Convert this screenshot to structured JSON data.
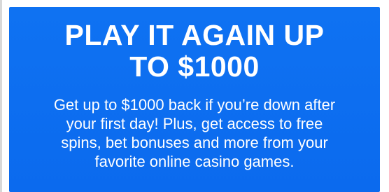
{
  "promo": {
    "headline_lines": [
      "PLAY IT AGAIN UP",
      "TO $1000"
    ],
    "description_lines": [
      "Get up to $1000 back if you’re down after",
      "your first day! Plus, get access to free",
      "spins, bet bonuses and more from your",
      "favorite online casino games."
    ]
  },
  "colors": {
    "card_background": "#0d6ff0",
    "text": "#ffffff"
  }
}
